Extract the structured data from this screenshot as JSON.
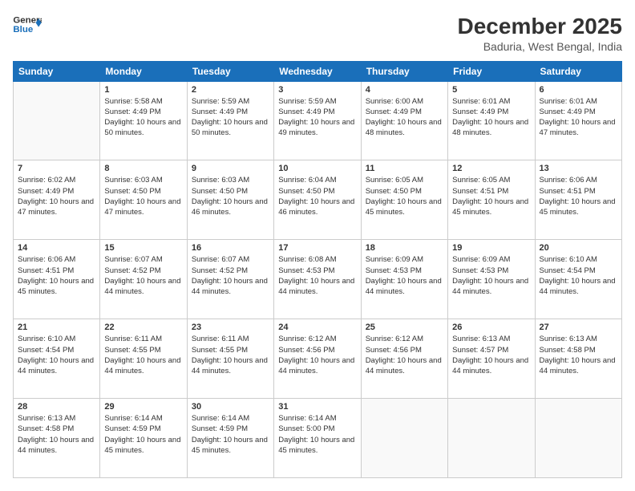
{
  "logo": {
    "line1": "General",
    "line2": "Blue"
  },
  "header": {
    "month": "December 2025",
    "location": "Baduria, West Bengal, India"
  },
  "weekdays": [
    "Sunday",
    "Monday",
    "Tuesday",
    "Wednesday",
    "Thursday",
    "Friday",
    "Saturday"
  ],
  "weeks": [
    [
      {
        "day": "",
        "empty": true
      },
      {
        "day": "1",
        "sunrise": "Sunrise: 5:58 AM",
        "sunset": "Sunset: 4:49 PM",
        "daylight": "Daylight: 10 hours and 50 minutes."
      },
      {
        "day": "2",
        "sunrise": "Sunrise: 5:59 AM",
        "sunset": "Sunset: 4:49 PM",
        "daylight": "Daylight: 10 hours and 50 minutes."
      },
      {
        "day": "3",
        "sunrise": "Sunrise: 5:59 AM",
        "sunset": "Sunset: 4:49 PM",
        "daylight": "Daylight: 10 hours and 49 minutes."
      },
      {
        "day": "4",
        "sunrise": "Sunrise: 6:00 AM",
        "sunset": "Sunset: 4:49 PM",
        "daylight": "Daylight: 10 hours and 48 minutes."
      },
      {
        "day": "5",
        "sunrise": "Sunrise: 6:01 AM",
        "sunset": "Sunset: 4:49 PM",
        "daylight": "Daylight: 10 hours and 48 minutes."
      },
      {
        "day": "6",
        "sunrise": "Sunrise: 6:01 AM",
        "sunset": "Sunset: 4:49 PM",
        "daylight": "Daylight: 10 hours and 47 minutes."
      }
    ],
    [
      {
        "day": "7",
        "sunrise": "Sunrise: 6:02 AM",
        "sunset": "Sunset: 4:49 PM",
        "daylight": "Daylight: 10 hours and 47 minutes."
      },
      {
        "day": "8",
        "sunrise": "Sunrise: 6:03 AM",
        "sunset": "Sunset: 4:50 PM",
        "daylight": "Daylight: 10 hours and 47 minutes."
      },
      {
        "day": "9",
        "sunrise": "Sunrise: 6:03 AM",
        "sunset": "Sunset: 4:50 PM",
        "daylight": "Daylight: 10 hours and 46 minutes."
      },
      {
        "day": "10",
        "sunrise": "Sunrise: 6:04 AM",
        "sunset": "Sunset: 4:50 PM",
        "daylight": "Daylight: 10 hours and 46 minutes."
      },
      {
        "day": "11",
        "sunrise": "Sunrise: 6:05 AM",
        "sunset": "Sunset: 4:50 PM",
        "daylight": "Daylight: 10 hours and 45 minutes."
      },
      {
        "day": "12",
        "sunrise": "Sunrise: 6:05 AM",
        "sunset": "Sunset: 4:51 PM",
        "daylight": "Daylight: 10 hours and 45 minutes."
      },
      {
        "day": "13",
        "sunrise": "Sunrise: 6:06 AM",
        "sunset": "Sunset: 4:51 PM",
        "daylight": "Daylight: 10 hours and 45 minutes."
      }
    ],
    [
      {
        "day": "14",
        "sunrise": "Sunrise: 6:06 AM",
        "sunset": "Sunset: 4:51 PM",
        "daylight": "Daylight: 10 hours and 45 minutes."
      },
      {
        "day": "15",
        "sunrise": "Sunrise: 6:07 AM",
        "sunset": "Sunset: 4:52 PM",
        "daylight": "Daylight: 10 hours and 44 minutes."
      },
      {
        "day": "16",
        "sunrise": "Sunrise: 6:07 AM",
        "sunset": "Sunset: 4:52 PM",
        "daylight": "Daylight: 10 hours and 44 minutes."
      },
      {
        "day": "17",
        "sunrise": "Sunrise: 6:08 AM",
        "sunset": "Sunset: 4:53 PM",
        "daylight": "Daylight: 10 hours and 44 minutes."
      },
      {
        "day": "18",
        "sunrise": "Sunrise: 6:09 AM",
        "sunset": "Sunset: 4:53 PM",
        "daylight": "Daylight: 10 hours and 44 minutes."
      },
      {
        "day": "19",
        "sunrise": "Sunrise: 6:09 AM",
        "sunset": "Sunset: 4:53 PM",
        "daylight": "Daylight: 10 hours and 44 minutes."
      },
      {
        "day": "20",
        "sunrise": "Sunrise: 6:10 AM",
        "sunset": "Sunset: 4:54 PM",
        "daylight": "Daylight: 10 hours and 44 minutes."
      }
    ],
    [
      {
        "day": "21",
        "sunrise": "Sunrise: 6:10 AM",
        "sunset": "Sunset: 4:54 PM",
        "daylight": "Daylight: 10 hours and 44 minutes."
      },
      {
        "day": "22",
        "sunrise": "Sunrise: 6:11 AM",
        "sunset": "Sunset: 4:55 PM",
        "daylight": "Daylight: 10 hours and 44 minutes."
      },
      {
        "day": "23",
        "sunrise": "Sunrise: 6:11 AM",
        "sunset": "Sunset: 4:55 PM",
        "daylight": "Daylight: 10 hours and 44 minutes."
      },
      {
        "day": "24",
        "sunrise": "Sunrise: 6:12 AM",
        "sunset": "Sunset: 4:56 PM",
        "daylight": "Daylight: 10 hours and 44 minutes."
      },
      {
        "day": "25",
        "sunrise": "Sunrise: 6:12 AM",
        "sunset": "Sunset: 4:56 PM",
        "daylight": "Daylight: 10 hours and 44 minutes."
      },
      {
        "day": "26",
        "sunrise": "Sunrise: 6:13 AM",
        "sunset": "Sunset: 4:57 PM",
        "daylight": "Daylight: 10 hours and 44 minutes."
      },
      {
        "day": "27",
        "sunrise": "Sunrise: 6:13 AM",
        "sunset": "Sunset: 4:58 PM",
        "daylight": "Daylight: 10 hours and 44 minutes."
      }
    ],
    [
      {
        "day": "28",
        "sunrise": "Sunrise: 6:13 AM",
        "sunset": "Sunset: 4:58 PM",
        "daylight": "Daylight: 10 hours and 44 minutes."
      },
      {
        "day": "29",
        "sunrise": "Sunrise: 6:14 AM",
        "sunset": "Sunset: 4:59 PM",
        "daylight": "Daylight: 10 hours and 45 minutes."
      },
      {
        "day": "30",
        "sunrise": "Sunrise: 6:14 AM",
        "sunset": "Sunset: 4:59 PM",
        "daylight": "Daylight: 10 hours and 45 minutes."
      },
      {
        "day": "31",
        "sunrise": "Sunrise: 6:14 AM",
        "sunset": "Sunset: 5:00 PM",
        "daylight": "Daylight: 10 hours and 45 minutes."
      },
      {
        "day": "",
        "empty": true
      },
      {
        "day": "",
        "empty": true
      },
      {
        "day": "",
        "empty": true
      }
    ]
  ]
}
